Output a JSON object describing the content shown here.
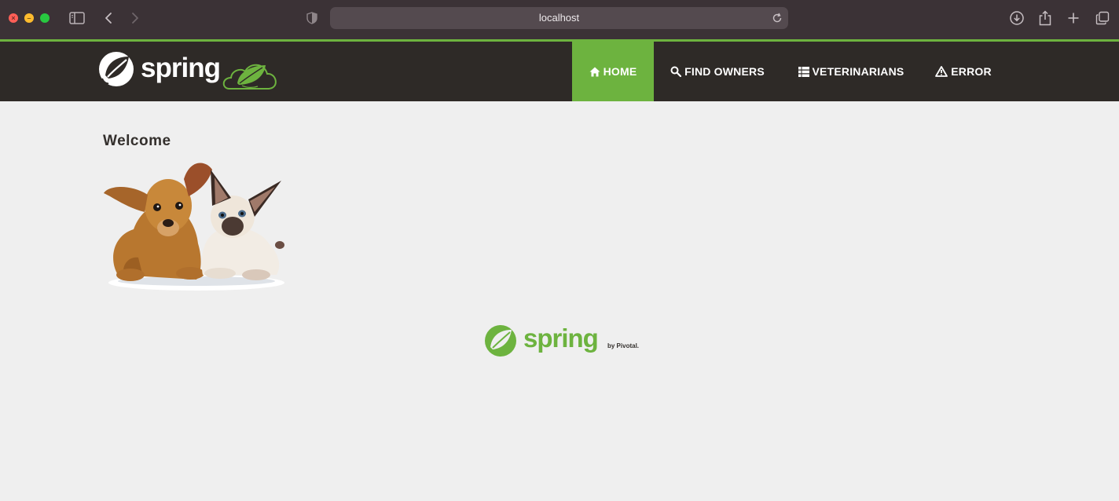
{
  "browser": {
    "url": "localhost",
    "buttons": [
      "sidebar-toggle",
      "back",
      "forward",
      "download",
      "share",
      "new-tab",
      "tab-overview"
    ]
  },
  "brand": {
    "wordmark": "spring"
  },
  "nav": {
    "items": [
      {
        "label": "HOME",
        "icon": "home-icon",
        "active": true
      },
      {
        "label": "FIND OWNERS",
        "icon": "search-icon",
        "active": false
      },
      {
        "label": "VETERINARIANS",
        "icon": "list-icon",
        "active": false
      },
      {
        "label": "ERROR",
        "icon": "warning-icon",
        "active": false
      }
    ]
  },
  "main": {
    "heading": "Welcome",
    "image_alt": "puppy and kitten"
  },
  "footer": {
    "wordmark": "spring",
    "byline": "by Pivotal."
  },
  "colors": {
    "accent": "#6db33f",
    "navbar": "#2e2a27",
    "background": "#efefef",
    "chrome": "#3b3236"
  }
}
